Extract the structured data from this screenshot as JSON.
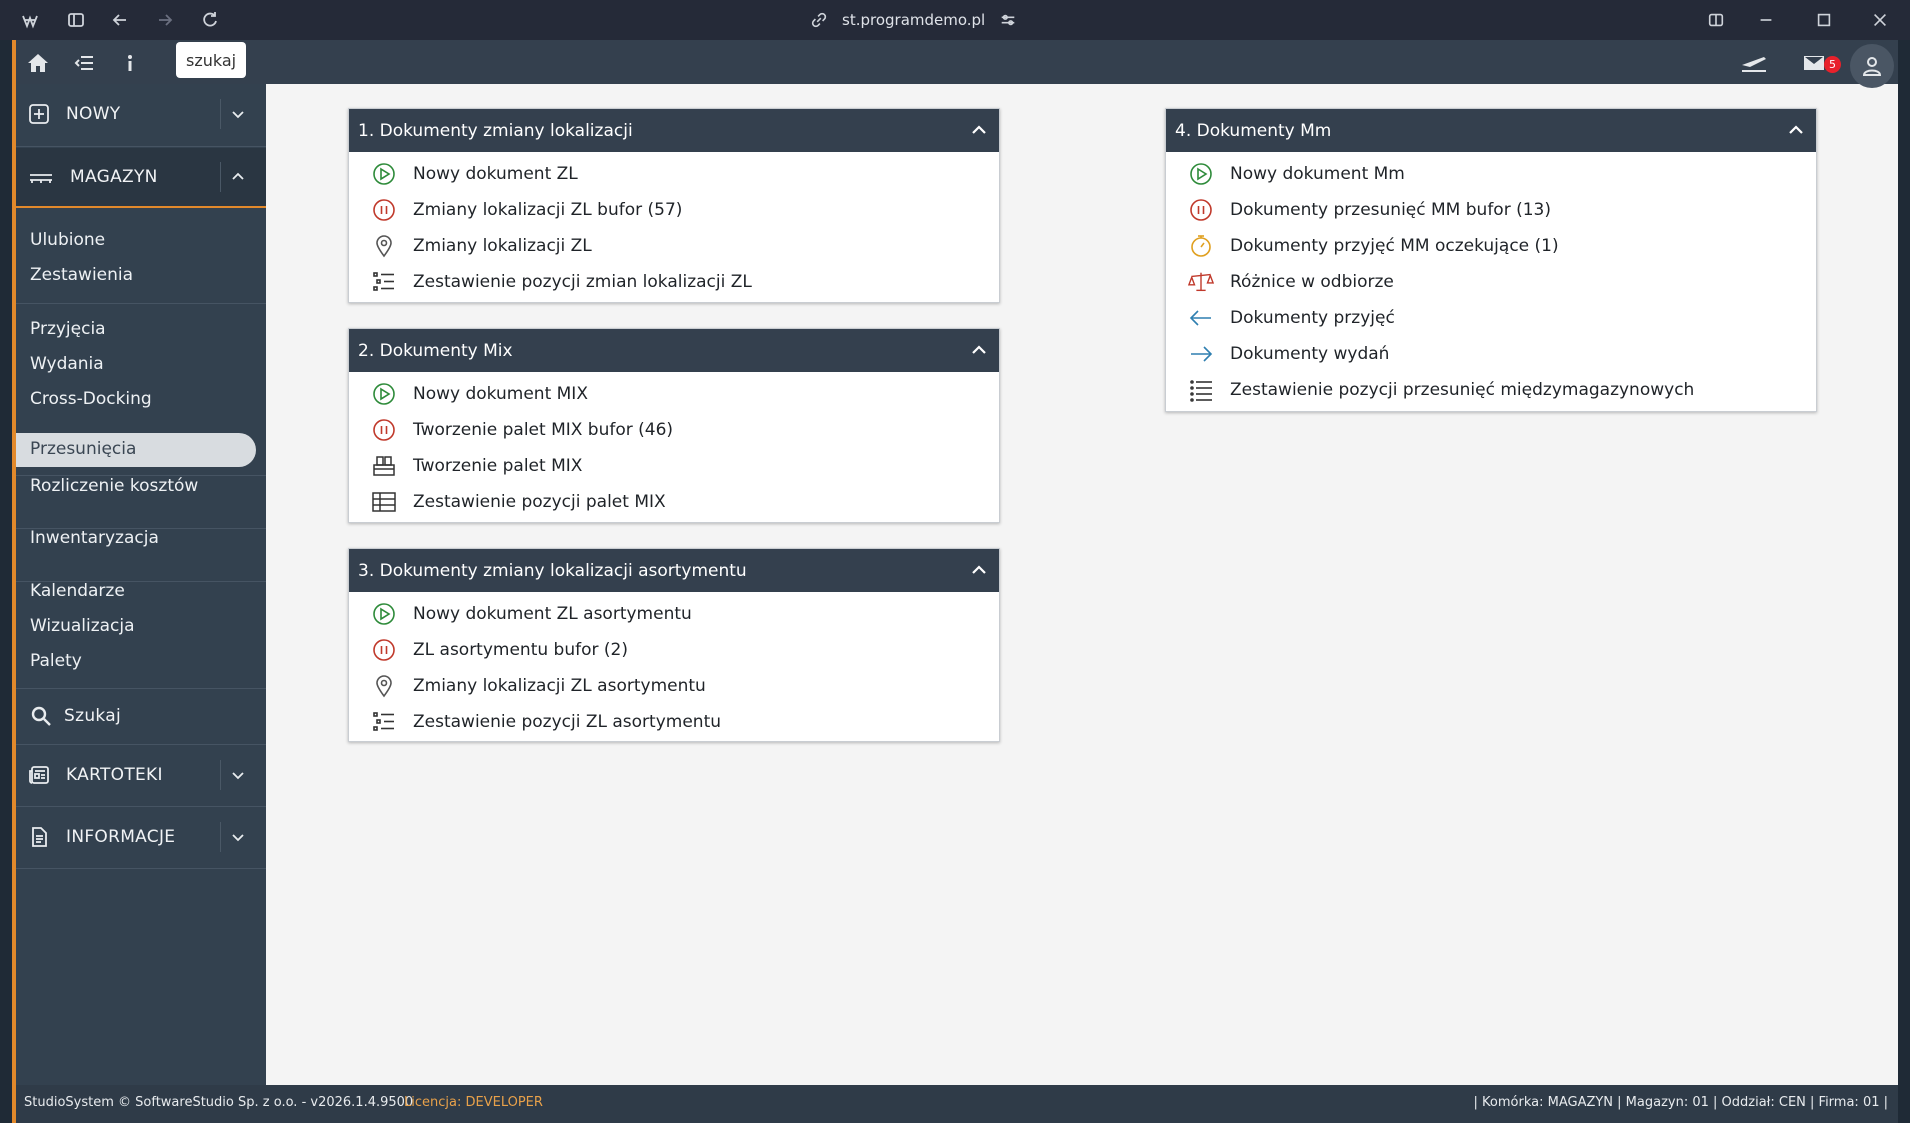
{
  "browser": {
    "url": "st.programdemo.pl"
  },
  "topbar": {
    "search_chip": "szukaj",
    "mail_count": "5"
  },
  "sidebar": {
    "nowy": "NOWY",
    "magazyn": "MAGAZYN",
    "links_group1": [
      "Ulubione",
      "Zestawienia"
    ],
    "links_group2": [
      "Przyjęcia",
      "Wydania",
      "Cross-Docking"
    ],
    "active": "Przesunięcia",
    "rozliczenie": "Rozliczenie kosztów",
    "inwentaryzacja": "Inwentaryzacja",
    "links_group3": [
      "Kalendarze",
      "Wizualizacja",
      "Palety"
    ],
    "szukaj": "Szukaj",
    "kartoteki": "KARTOTEKI",
    "informacje": "INFORMACJE"
  },
  "panels": [
    {
      "title": "1. Dokumenty zmiany lokalizacji",
      "items": [
        {
          "icon": "play-circle-icon",
          "label": "Nowy dokument ZL"
        },
        {
          "icon": "pause-circle-icon",
          "label": "Zmiany lokalizacji ZL bufor (57)"
        },
        {
          "icon": "location-pin-icon",
          "label": "Zmiany lokalizacji ZL"
        },
        {
          "icon": "list-tree-icon",
          "label": "Zestawienie pozycji zmian lokalizacji ZL"
        }
      ]
    },
    {
      "title": "2. Dokumenty Mix",
      "items": [
        {
          "icon": "play-circle-icon",
          "label": "Nowy dokument MIX"
        },
        {
          "icon": "pause-circle-icon",
          "label": "Tworzenie palet MIX bufor (46)"
        },
        {
          "icon": "boxes-icon",
          "label": "Tworzenie palet MIX"
        },
        {
          "icon": "table-icon",
          "label": "Zestawienie pozycji palet MIX"
        }
      ]
    },
    {
      "title": "3. Dokumenty zmiany lokalizacji asortymentu",
      "items": [
        {
          "icon": "play-circle-icon",
          "label": "Nowy dokument ZL asortymentu"
        },
        {
          "icon": "pause-circle-icon",
          "label": "ZL asortymentu bufor (2)"
        },
        {
          "icon": "location-pin-icon",
          "label": "Zmiany lokalizacji ZL asortymentu"
        },
        {
          "icon": "list-tree-icon",
          "label": "Zestawienie pozycji ZL asortymentu"
        }
      ]
    },
    {
      "title": "4. Dokumenty Mm",
      "items": [
        {
          "icon": "play-circle-icon",
          "label": "Nowy dokument Mm"
        },
        {
          "icon": "pause-circle-icon",
          "label": "Dokumenty przesunięć MM bufor (13)"
        },
        {
          "icon": "stopwatch-icon",
          "label": "Dokumenty przyjęć MM oczekujące (1)"
        },
        {
          "icon": "scale-icon",
          "label": "Różnice w odbiorze"
        },
        {
          "icon": "arrow-left-icon",
          "label": "Dokumenty przyjęć"
        },
        {
          "icon": "arrow-right-icon",
          "label": "Dokumenty wydań"
        },
        {
          "icon": "list-icon",
          "label": "Zestawienie pozycji przesunięć międzymagazynowych"
        }
      ]
    }
  ],
  "footer": {
    "copyright": "StudioSystem © SoftwareStudio Sp. z o.o. - v2026.1.4.9500",
    "license_label": "Licencja:",
    "license_value": "DEVELOPER",
    "status": "| Komórka: MAGAZYN | Magazyn: 01 | Oddział: CEN | Firma: 01 |"
  },
  "colors": {
    "sidebar": "#33414f",
    "panel_header": "#34404e",
    "accent_orange": "#e2892b",
    "green_icon": "#2e8b3a",
    "red_icon": "#c0392b",
    "amber_icon": "#e0a020",
    "blue_icon": "#2f7fb0"
  }
}
